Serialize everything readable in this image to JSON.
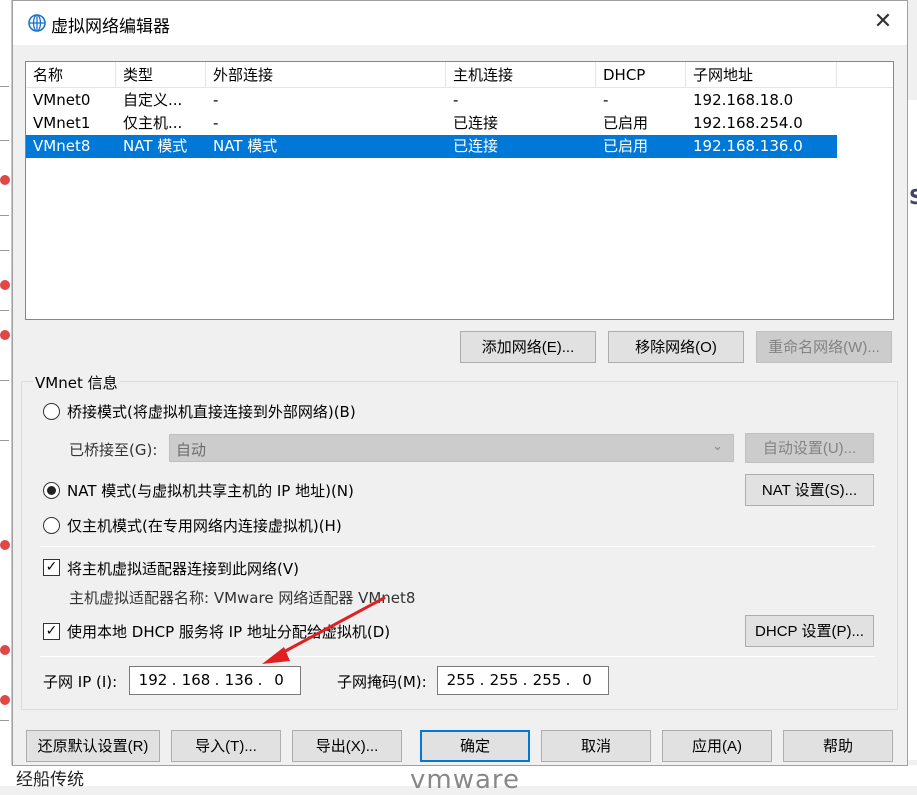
{
  "background": {
    "bottom_left_text": "经船传统",
    "bottom_right_text": "vmware",
    "right_text": "S"
  },
  "dialog": {
    "title": "虚拟网络编辑器",
    "close_glyph": "✕"
  },
  "network_list": {
    "columns": [
      "名称",
      "类型",
      "外部连接",
      "主机连接",
      "DHCP",
      "子网地址"
    ],
    "rows": [
      {
        "name": "VMnet0",
        "type": "自定义...",
        "external": "-",
        "host": "-",
        "dhcp": "-",
        "subnet": "192.168.18.0",
        "selected": false
      },
      {
        "name": "VMnet1",
        "type": "仅主机...",
        "external": "-",
        "host": "已连接",
        "dhcp": "已启用",
        "subnet": "192.168.254.0",
        "selected": false
      },
      {
        "name": "VMnet8",
        "type": "NAT 模式",
        "external": "NAT 模式",
        "host": "已连接",
        "dhcp": "已启用",
        "subnet": "192.168.136.0",
        "selected": true
      }
    ]
  },
  "list_buttons": {
    "add": "添加网络(E)...",
    "remove": "移除网络(O)",
    "rename": "重命名网络(W)..."
  },
  "vmnet_info": {
    "legend": "VMnet 信息",
    "bridge_label": "桥接模式(将虚拟机直接连接到外部网络)(B)",
    "bridged_to_label": "已桥接至(G):",
    "bridged_to_value": "自动",
    "auto_settings": "自动设置(U)...",
    "nat_label": "NAT 模式(与虚拟机共享主机的 IP 地址)(N)",
    "nat_settings": "NAT 设置(S)...",
    "hostonly_label": "仅主机模式(在专用网络内连接虚拟机)(H)",
    "selected_mode": "nat",
    "connect_adapter_label": "将主机虚拟适配器连接到此网络(V)",
    "connect_adapter_checked": true,
    "adapter_name_text": "主机虚拟适配器名称: VMware 网络适配器 VMnet8",
    "use_dhcp_label": "使用本地 DHCP 服务将 IP 地址分配给虚拟机(D)",
    "use_dhcp_checked": true,
    "dhcp_settings": "DHCP 设置(P)...",
    "subnet_ip_label": "子网 IP (I):",
    "subnet_ip": [
      "192",
      "168",
      "136",
      "0"
    ],
    "subnet_mask_label": "子网掩码(M):",
    "subnet_mask": [
      "255",
      "255",
      "255",
      "0"
    ]
  },
  "footer_buttons": {
    "restore": "还原默认设置(R)",
    "import": "导入(T)...",
    "export": "导出(X)...",
    "ok": "确定",
    "cancel": "取消",
    "apply": "应用(A)",
    "help": "帮助"
  },
  "colors": {
    "selection": "#0078d7",
    "annotation_arrow": "#e02020"
  }
}
